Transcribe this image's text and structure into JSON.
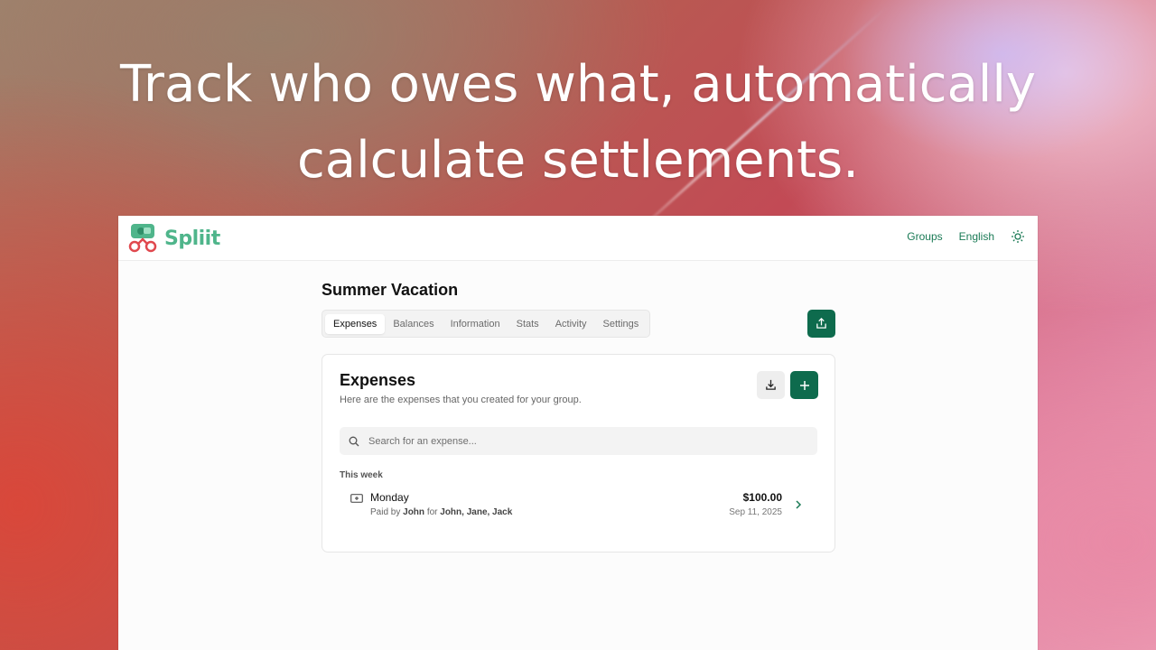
{
  "promo": {
    "headline_line1": "Track who owes what, automatically",
    "headline_line2": "calculate settlements."
  },
  "app": {
    "brand": "Spliit",
    "nav": {
      "groups": "Groups",
      "language": "English",
      "theme_icon": "sun-icon"
    },
    "group": {
      "title": "Summer Vacation",
      "tabs": [
        {
          "label": "Expenses",
          "active": true
        },
        {
          "label": "Balances",
          "active": false
        },
        {
          "label": "Information",
          "active": false
        },
        {
          "label": "Stats",
          "active": false
        },
        {
          "label": "Activity",
          "active": false
        },
        {
          "label": "Settings",
          "active": false
        }
      ],
      "share_icon": "share-icon"
    },
    "expenses_card": {
      "title": "Expenses",
      "description": "Here are the expenses that you created for your group.",
      "export_icon": "download-icon",
      "add_icon": "plus-icon",
      "search_placeholder": "Search for an expense...",
      "section_label": "This week",
      "items": [
        {
          "title": "Monday",
          "paid_by_prefix": "Paid by",
          "payer": "John",
          "for_word": "for",
          "participants": "John, Jane, Jack",
          "amount": "$100.00",
          "date": "Sep 11, 2025"
        }
      ]
    },
    "colors": {
      "accent": "#0e6b4d",
      "brand": "#4fb58b",
      "link": "#1a7a55"
    }
  }
}
